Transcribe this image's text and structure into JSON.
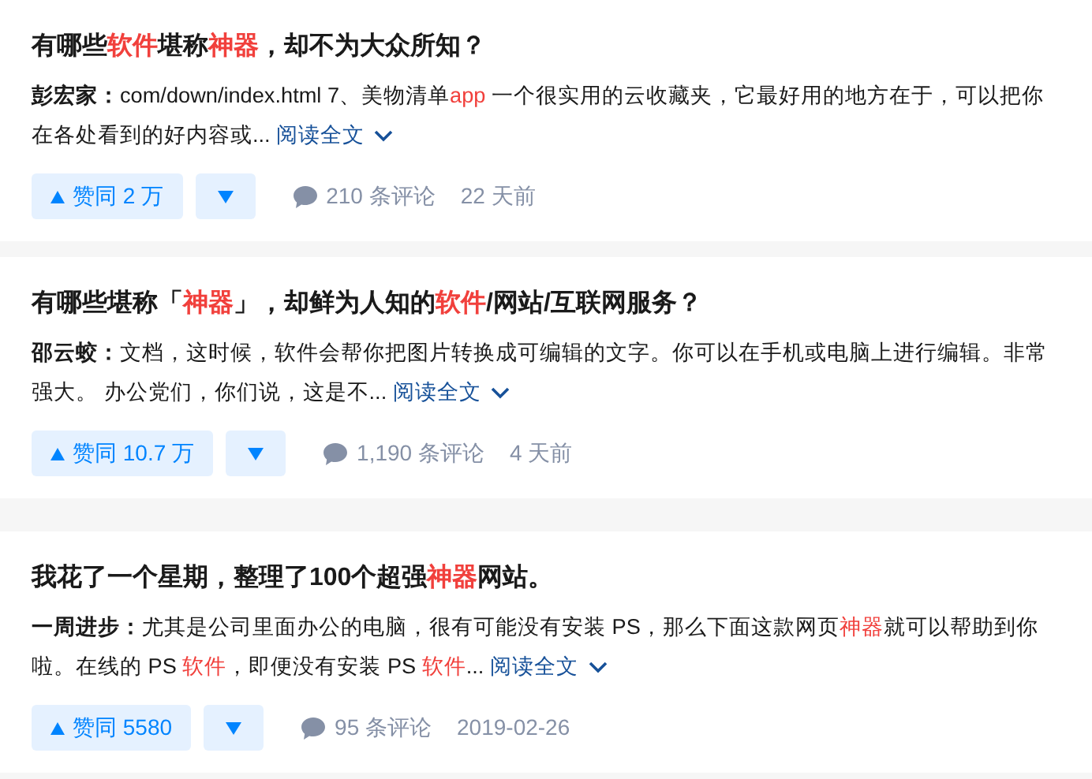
{
  "answers": [
    {
      "title": [
        {
          "text": "有哪些",
          "highlight": false
        },
        {
          "text": "软件",
          "highlight": true
        },
        {
          "text": "堪称",
          "highlight": false
        },
        {
          "text": "神器",
          "highlight": true
        },
        {
          "text": "，却不为大众所知？",
          "highlight": false
        }
      ],
      "author": "彭宏家：",
      "excerpt": [
        {
          "text": "com/down/index.html 7、美物清单",
          "highlight": false
        },
        {
          "text": "app",
          "highlight": true
        },
        {
          "text": " 一个很实用的云收藏夹，它最好用的地方在于，可以把你在各处看到的好内容或...",
          "highlight": false
        }
      ],
      "read_more": "阅读全文",
      "upvote": "赞同 2 万",
      "comments": "210 条评论",
      "time": "22 天前"
    },
    {
      "title": [
        {
          "text": "有哪些堪称「",
          "highlight": false
        },
        {
          "text": "神器",
          "highlight": true
        },
        {
          "text": "」，却鲜为人知的",
          "highlight": false
        },
        {
          "text": "软件",
          "highlight": true
        },
        {
          "text": "/网站/互联网服务？",
          "highlight": false
        }
      ],
      "author": "邵云蛟：",
      "excerpt": [
        {
          "text": "文档，这时候，软件会帮你把图片转换成可编辑的文字。你可以在手机或电脑上进行编辑。非常强大。 办公党们，你们说，这是不...",
          "highlight": false
        }
      ],
      "read_more": "阅读全文",
      "upvote": "赞同 10.7 万",
      "comments": "1,190 条评论",
      "time": "4 天前"
    },
    {
      "title": [
        {
          "text": "我花了一个星期，整理了100个超强",
          "highlight": false
        },
        {
          "text": "神器",
          "highlight": true
        },
        {
          "text": "网站。",
          "highlight": false
        }
      ],
      "author": "一周进步：",
      "excerpt": [
        {
          "text": "尤其是公司里面办公的电脑，很有可能没有安装 PS，那么下面这款网页",
          "highlight": false
        },
        {
          "text": "神器",
          "highlight": true
        },
        {
          "text": "就可以帮助到你啦。在线的 PS ",
          "highlight": false
        },
        {
          "text": "软件",
          "highlight": true
        },
        {
          "text": "，即便没有安装 PS ",
          "highlight": false
        },
        {
          "text": "软件",
          "highlight": true
        },
        {
          "text": "...",
          "highlight": false
        }
      ],
      "read_more": "阅读全文",
      "upvote": "赞同 5580",
      "comments": "95 条评论",
      "time": "2019-02-26"
    }
  ]
}
